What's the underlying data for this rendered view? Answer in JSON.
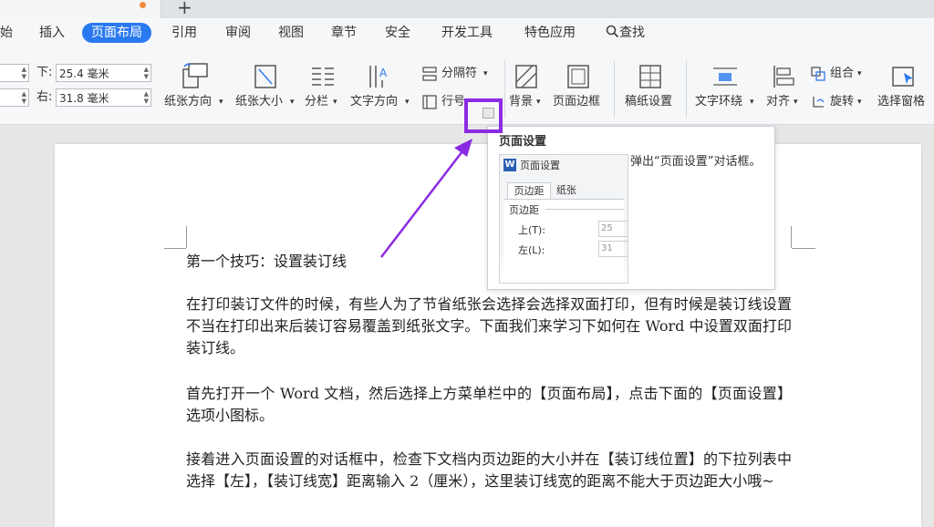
{
  "tabs": {
    "new_tab": "+"
  },
  "menu": {
    "items": [
      "始",
      "插入",
      "页面布局",
      "引用",
      "审阅",
      "视图",
      "章节",
      "安全",
      "开发工具",
      "特色应用"
    ],
    "active_index": 2,
    "search_label": "查找"
  },
  "margins": {
    "bottom_label": "下:",
    "bottom_value": "25.4 毫米",
    "right_label": "右:",
    "right_value": "31.8 毫米"
  },
  "toolbar": {
    "orientation": "纸张方向",
    "paper_size": "纸张大小",
    "columns": "分栏",
    "text_direction": "文字方向",
    "separator": "分隔符",
    "line_number": "行号",
    "background": "背景",
    "page_border": "页面边框",
    "draft_setting": "稿纸设置",
    "text_wrap": "文字环绕",
    "align": "对齐",
    "group": "组合",
    "rotate": "旋转",
    "select_pane": "选择窗格"
  },
  "tooltip": {
    "title": "页面设置",
    "preview_title": "页面设置",
    "preview_tab1": "页边距",
    "preview_tab2": "纸张",
    "preview_group": "页边距",
    "preview_top": "上(T):",
    "preview_left": "左(L):",
    "preview_top_val": "25",
    "preview_left_val": "31",
    "description": "弹出“页面设置”对话框。"
  },
  "document": {
    "heading": "第一个技巧：设置装订线",
    "p1": "在打印装订文件的时候，有些人为了节省纸张会选择会选择双面打印，但有时候是装订线设置不当在打印出来后装订容易覆盖到纸张文字。下面我们来学习下如何在 Word 中设置双面打印装订线。",
    "p2": "首先打开一个 Word 文档，然后选择上方菜单栏中的【页面布局】，点击下面的【页面设置】选项小图标。",
    "p3": "接着进入页面设置的对话框中，检查下文档内页边距的大小并在【装订线位置】的下拉列表中选择【左】，【装订线宽】距离输入 2（厘米），这里装订线宽的距离不能大于页边距大小哦~"
  },
  "colors": {
    "accent": "#2b79f0",
    "highlight": "#8a2be2"
  }
}
